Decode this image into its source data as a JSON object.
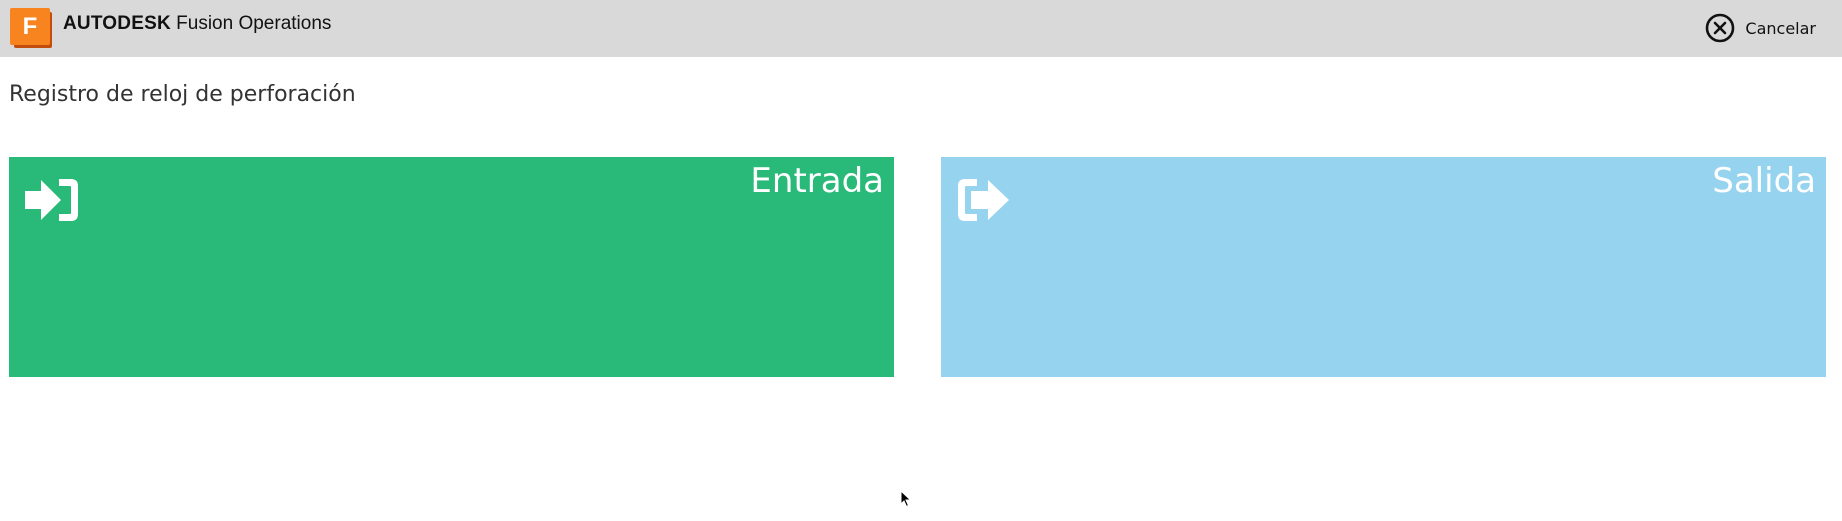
{
  "header": {
    "logo_letter": "F",
    "brand_bold": "AUTODESK",
    "brand_product": "Fusion Operations",
    "cancel_label": "Cancelar",
    "cancel_icon": "close-circle-icon"
  },
  "page": {
    "title": "Registro de reloj de perforación"
  },
  "tiles": [
    {
      "label": "Entrada",
      "icon": "sign-in-icon",
      "color": "#29b979"
    },
    {
      "label": "Salida",
      "icon": "sign-out-icon",
      "color": "#96d3ef"
    }
  ],
  "colors": {
    "topbar": "#d9d9d9",
    "logo_orange": "#f7841f",
    "logo_dark": "#c24d0c"
  }
}
